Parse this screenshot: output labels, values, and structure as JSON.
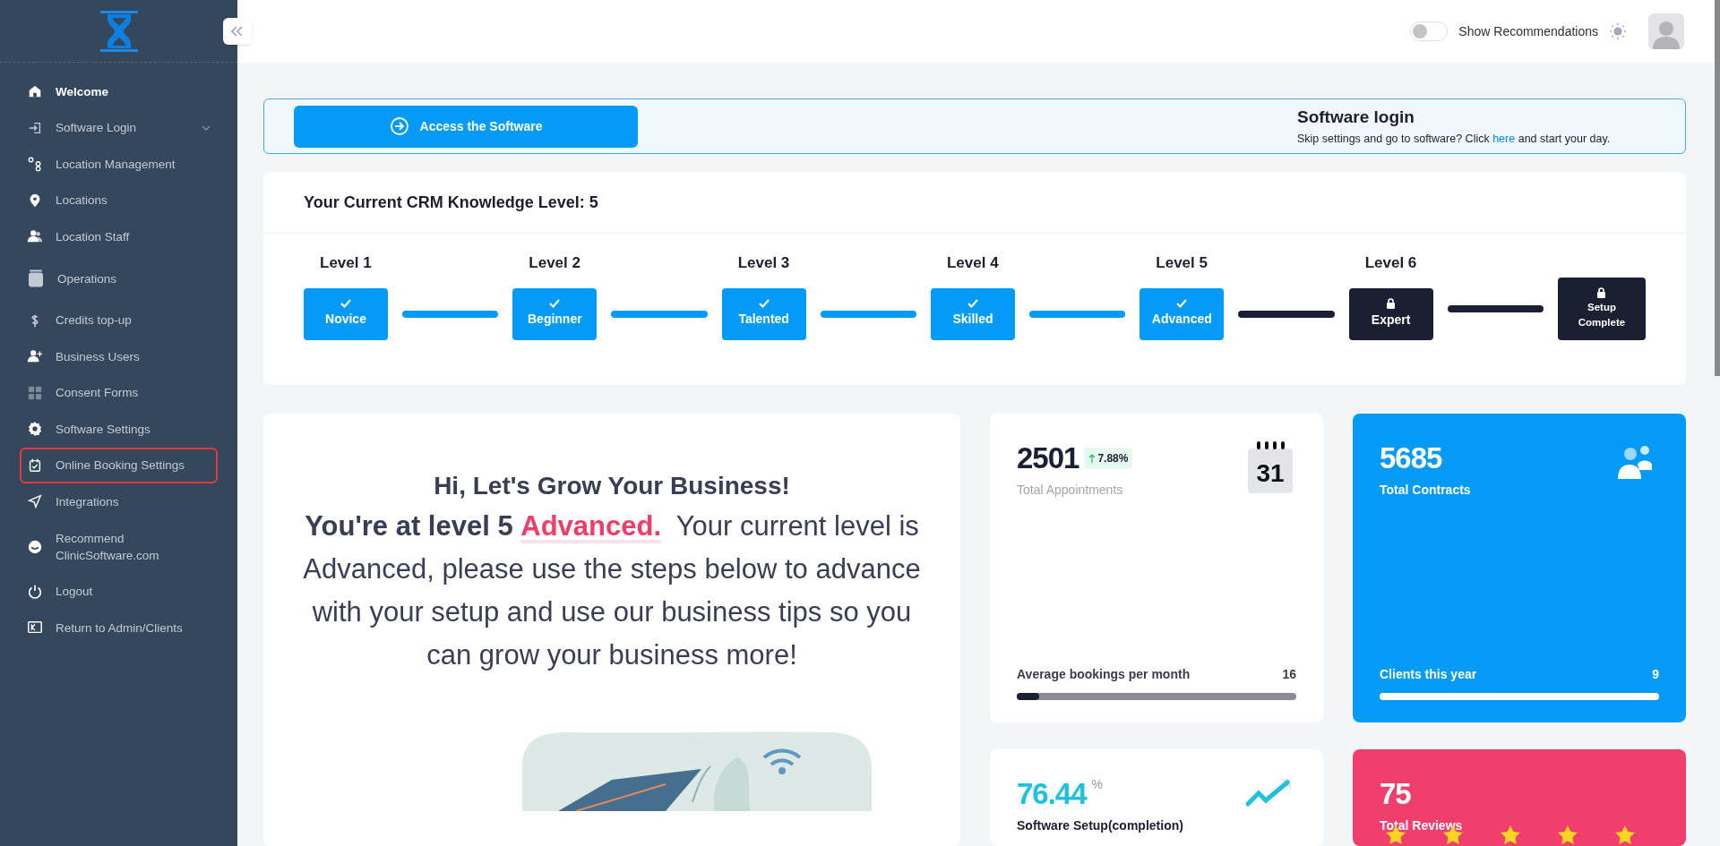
{
  "sidebar": {
    "items": [
      {
        "label": "Welcome",
        "selected": true,
        "highlighted": false
      },
      {
        "label": "Software Login",
        "selected": false,
        "highlighted": false,
        "expandable": true
      },
      {
        "label": "Location Management",
        "selected": false,
        "highlighted": false
      },
      {
        "label": "Locations",
        "selected": false,
        "highlighted": false
      },
      {
        "label": "Location Staff",
        "selected": false,
        "highlighted": false
      },
      {
        "label": "Operations",
        "selected": false,
        "highlighted": false
      },
      {
        "label": "Credits top-up",
        "selected": false,
        "highlighted": false
      },
      {
        "label": "Business Users",
        "selected": false,
        "highlighted": false
      },
      {
        "label": "Consent Forms",
        "selected": false,
        "highlighted": false
      },
      {
        "label": "Software Settings",
        "selected": false,
        "highlighted": false
      },
      {
        "label": "Online Booking Settings",
        "selected": false,
        "highlighted": true
      },
      {
        "label": "Integrations",
        "selected": false,
        "highlighted": false
      },
      {
        "label": "Recommend ClinicSoftware.com",
        "selected": false,
        "highlighted": false
      },
      {
        "label": "Logout",
        "selected": false,
        "highlighted": false
      },
      {
        "label": "Return to Admin/Clients",
        "selected": false,
        "highlighted": false
      }
    ]
  },
  "header": {
    "recommendations_toggle": {
      "label": "Show Recommendations",
      "on": false
    }
  },
  "login_banner": {
    "button": "Access the Software",
    "title": "Software login",
    "text": "Skip settings and go to software? Click ",
    "link": "here",
    "text_end": " and start your day."
  },
  "knowledge": {
    "title": "Your Current CRM Knowledge Level: 5",
    "steps": [
      {
        "level": "Level 1",
        "name": "Novice",
        "done": true
      },
      {
        "level": "Level 2",
        "name": "Beginner",
        "done": true
      },
      {
        "level": "Level 3",
        "name": "Talented",
        "done": true
      },
      {
        "level": "Level 4",
        "name": "Skilled",
        "done": true
      },
      {
        "level": "Level 5",
        "name": "Advanced",
        "done": true
      },
      {
        "level": "Level 6",
        "name": "Expert",
        "done": false
      },
      {
        "name": "Setup Complete",
        "done": false
      }
    ]
  },
  "welcome": {
    "title": "Hi, Let's Grow Your Business!",
    "lead": "You're at level 5 ",
    "level_name": "Advanced.",
    "text": "Your current level is Advanced, please use the steps below to advance with your setup and use our business tips so you can grow your business more!"
  },
  "stats": [
    {
      "kind": "appointments",
      "value": "2501",
      "change": "7.88%",
      "label": "Total Appointments",
      "calendar_day": "31",
      "footer_label": "Average bookings per month",
      "footer_value": "16",
      "level": 0.08
    },
    {
      "kind": "contracts",
      "value": "5685",
      "label": "Total Contracts",
      "footer_label": "Clients this year",
      "footer_value": "9",
      "level": 1
    },
    {
      "kind": "setup",
      "value": "76.44",
      "unit": "%",
      "label": "Software Setup(completion)"
    },
    {
      "kind": "reviews",
      "value": "75",
      "label": "Total Reviews",
      "stars": 5
    }
  ]
}
